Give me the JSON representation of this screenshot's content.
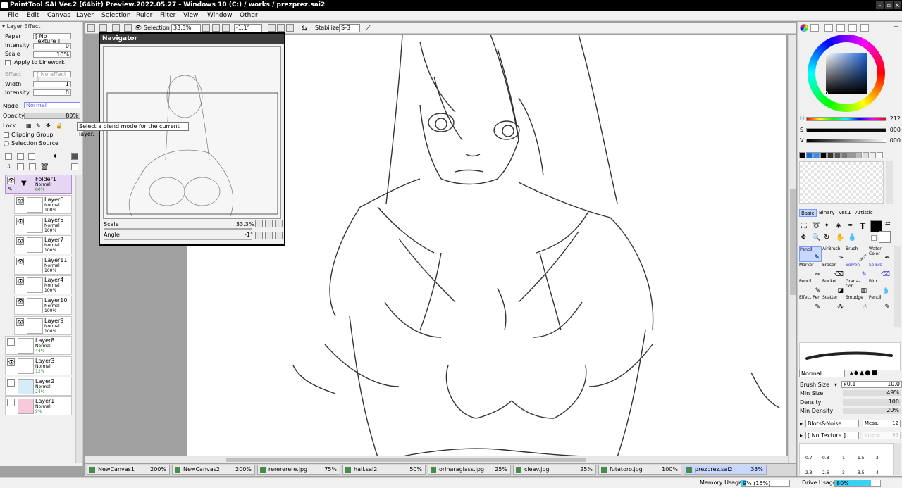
{
  "window": {
    "title": "PaintTool SAI Ver.2 (64bit) Preview.2022.05.27 - Windows 10 (C:) / works / prezprez.sai2"
  },
  "menu": [
    "File",
    "Edit",
    "Canvas",
    "Layer",
    "Selection",
    "Ruler",
    "Filter",
    "View",
    "Window",
    "Other"
  ],
  "toolbar": {
    "selection_label": "Selection",
    "zoom": "33.3%",
    "angle": "-1.1°",
    "stabilizer_label": "Stabilizer",
    "stabilizer_value": "S-3"
  },
  "layer_effect": {
    "header": "Layer Effect",
    "paper_label": "Paper",
    "paper_value": "[ No Texture ]",
    "intensity_label": "Intensity",
    "intensity_value": "0",
    "scale_label": "Scale",
    "scale_value": "10%",
    "apply_linework": "Apply to Linework",
    "effect_label": "Effect",
    "effect_value": "[ No effect ]",
    "width_label": "Width",
    "width_value": "1",
    "intensity2_label": "Intensity",
    "intensity2_value": "0"
  },
  "layer_props": {
    "mode_label": "Mode",
    "mode_value": "Normal",
    "opacity_label": "Opacity",
    "opacity_value": "80%",
    "lock_label": "Lock",
    "clipping_group": "Clipping Group",
    "selection_source": "Selection Source"
  },
  "tooltip": "Select a blend mode for the current layer.",
  "layers": [
    {
      "name": "Folder1",
      "mode": "Normal",
      "opacity": "80%",
      "visible": "👁"
    },
    {
      "name": "Layer6",
      "mode": "Normal",
      "opacity": "100%",
      "visible": "👁"
    },
    {
      "name": "Layer5",
      "mode": "Normal",
      "opacity": "100%",
      "visible": "👁"
    },
    {
      "name": "Layer7",
      "mode": "Normal",
      "opacity": "100%",
      "visible": "👁"
    },
    {
      "name": "Layer11",
      "mode": "Normal",
      "opacity": "100%",
      "visible": "👁"
    },
    {
      "name": "Layer4",
      "mode": "Normal",
      "opacity": "100%",
      "visible": "👁"
    },
    {
      "name": "Layer10",
      "mode": "Normal",
      "opacity": "100%",
      "visible": "👁"
    },
    {
      "name": "Layer9",
      "mode": "Normal",
      "opacity": "100%",
      "visible": "👁"
    },
    {
      "name": "Layer8",
      "mode": "Normal",
      "opacity": "44%",
      "visible": ""
    },
    {
      "name": "Layer3",
      "mode": "Normal",
      "opacity": "12%",
      "visible": "👁"
    },
    {
      "name": "Layer2",
      "mode": "Normal",
      "opacity": "24%",
      "visible": ""
    },
    {
      "name": "Layer1",
      "mode": "Normal",
      "opacity": "9%",
      "visible": ""
    }
  ],
  "navigator": {
    "title": "Navigator",
    "scale_label": "Scale",
    "scale_value": "33.3%",
    "angle_label": "Angle",
    "angle_value": "-1°"
  },
  "tabs": [
    {
      "name": "NewCanvas1",
      "zoom": "200%"
    },
    {
      "name": "NewCanvas2",
      "zoom": "200%"
    },
    {
      "name": "rerererere.jpg",
      "zoom": "75%"
    },
    {
      "name": "hall.sai2",
      "zoom": "50%"
    },
    {
      "name": "oriharaglass.jpg",
      "zoom": "25%"
    },
    {
      "name": "cleav.jpg",
      "zoom": "25%"
    },
    {
      "name": "futatoro.jpg",
      "zoom": "100%"
    },
    {
      "name": "prezprez.sai2",
      "zoom": "33%"
    }
  ],
  "status": {
    "memory_label": "Memory Usage",
    "memory_value": "9% (15%)",
    "memory_fraction": 0.09,
    "drive_label": "Drive Usage",
    "drive_value": "80%",
    "drive_fraction": 0.8
  },
  "color": {
    "h_label": "H",
    "h_value": "212",
    "s_label": "S",
    "s_value": "000",
    "v_label": "V",
    "v_value": "000",
    "foreground": "#000000",
    "background": "#ffffff",
    "accent": "#7b9cff"
  },
  "tool_tabs": [
    "Basic",
    "Binary",
    "Ver.1",
    "Artistic"
  ],
  "tools": [
    {
      "name": "Pencil",
      "icon": "pencil-icon"
    },
    {
      "name": "AirBrush",
      "icon": "airbrush-icon"
    },
    {
      "name": "Brush",
      "icon": "brush-icon"
    },
    {
      "name": "Water Color",
      "icon": "watercolor-icon"
    },
    {
      "name": "Marker",
      "icon": "marker-icon"
    },
    {
      "name": "Eraser",
      "icon": "eraser-icon"
    },
    {
      "name": "SelPen",
      "icon": "selpen-icon"
    },
    {
      "name": "SelErs",
      "icon": "selers-icon"
    },
    {
      "name": "Pencil",
      "icon": "pencil-icon"
    },
    {
      "name": "Bucket",
      "icon": "bucket-icon"
    },
    {
      "name": "Grada- tion",
      "icon": "gradation-icon"
    },
    {
      "name": "Blur",
      "icon": "blur-icon"
    },
    {
      "name": "Effect Pen",
      "icon": "effect-pen-icon"
    },
    {
      "name": "Scatter",
      "icon": "scatter-icon"
    },
    {
      "name": "Smudge",
      "icon": "smudge-icon"
    },
    {
      "name": "Pencil",
      "icon": "pencil-icon"
    }
  ],
  "brush": {
    "blend_mode": "Normal",
    "size_label": "Brush Size",
    "size_mult": "x0.1",
    "size_value": "10.0",
    "min_size_label": "Min Size",
    "min_size_value": "49%",
    "density_label": "Density",
    "density_value": "100",
    "min_density_label": "Min Density",
    "min_density_value": "20%",
    "shape": "Blots&Noise",
    "shape_label": "Mess.",
    "shape_value": "12",
    "texture": "[ No Texture ]",
    "texture_label": "Intens",
    "texture_value": "95",
    "sizes": [
      "0.7",
      "0.8",
      "1",
      "1.5",
      "2",
      "2.3",
      "2.6",
      "3",
      "3.5",
      "4"
    ]
  }
}
